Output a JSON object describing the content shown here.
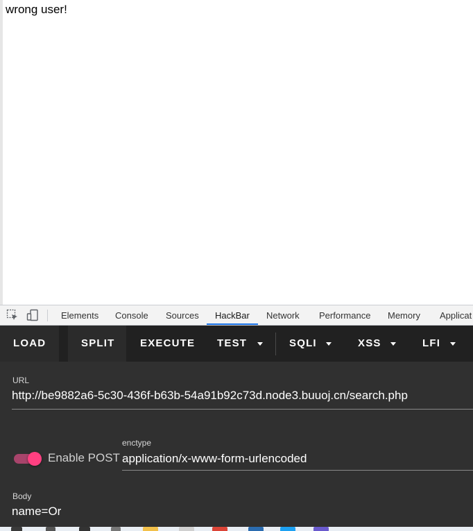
{
  "page": {
    "message": "wrong user!"
  },
  "devtools": {
    "tabs": [
      {
        "label": "Elements"
      },
      {
        "label": "Console"
      },
      {
        "label": "Sources"
      },
      {
        "label": "HackBar",
        "active": true
      },
      {
        "label": "Network"
      },
      {
        "label": "Performance"
      },
      {
        "label": "Memory"
      },
      {
        "label": "Applicat"
      }
    ],
    "accent_color": "#1a73e8",
    "icons": [
      "inspect-element-icon",
      "device-toolbar-icon"
    ]
  },
  "hackbar": {
    "buttons": {
      "load": "LOAD",
      "split": "SPLIT",
      "execute": "EXECUTE",
      "test": "TEST",
      "sqli": "SQLI",
      "xss": "XSS",
      "lfi": "LFI"
    },
    "url": {
      "label": "URL",
      "value": "http://be9882a6-5c30-436f-b63b-54a91b92c73d.node3.buuoj.cn/search.php"
    },
    "enable_post": {
      "label": "Enable POST",
      "enabled": true,
      "color": "#ff4081"
    },
    "enctype": {
      "label": "enctype",
      "value": "application/x-www-form-urlencoded"
    },
    "body": {
      "label": "Body",
      "value": "name=Or"
    },
    "background_color": "#303030",
    "toolbar_color": "#212121"
  }
}
